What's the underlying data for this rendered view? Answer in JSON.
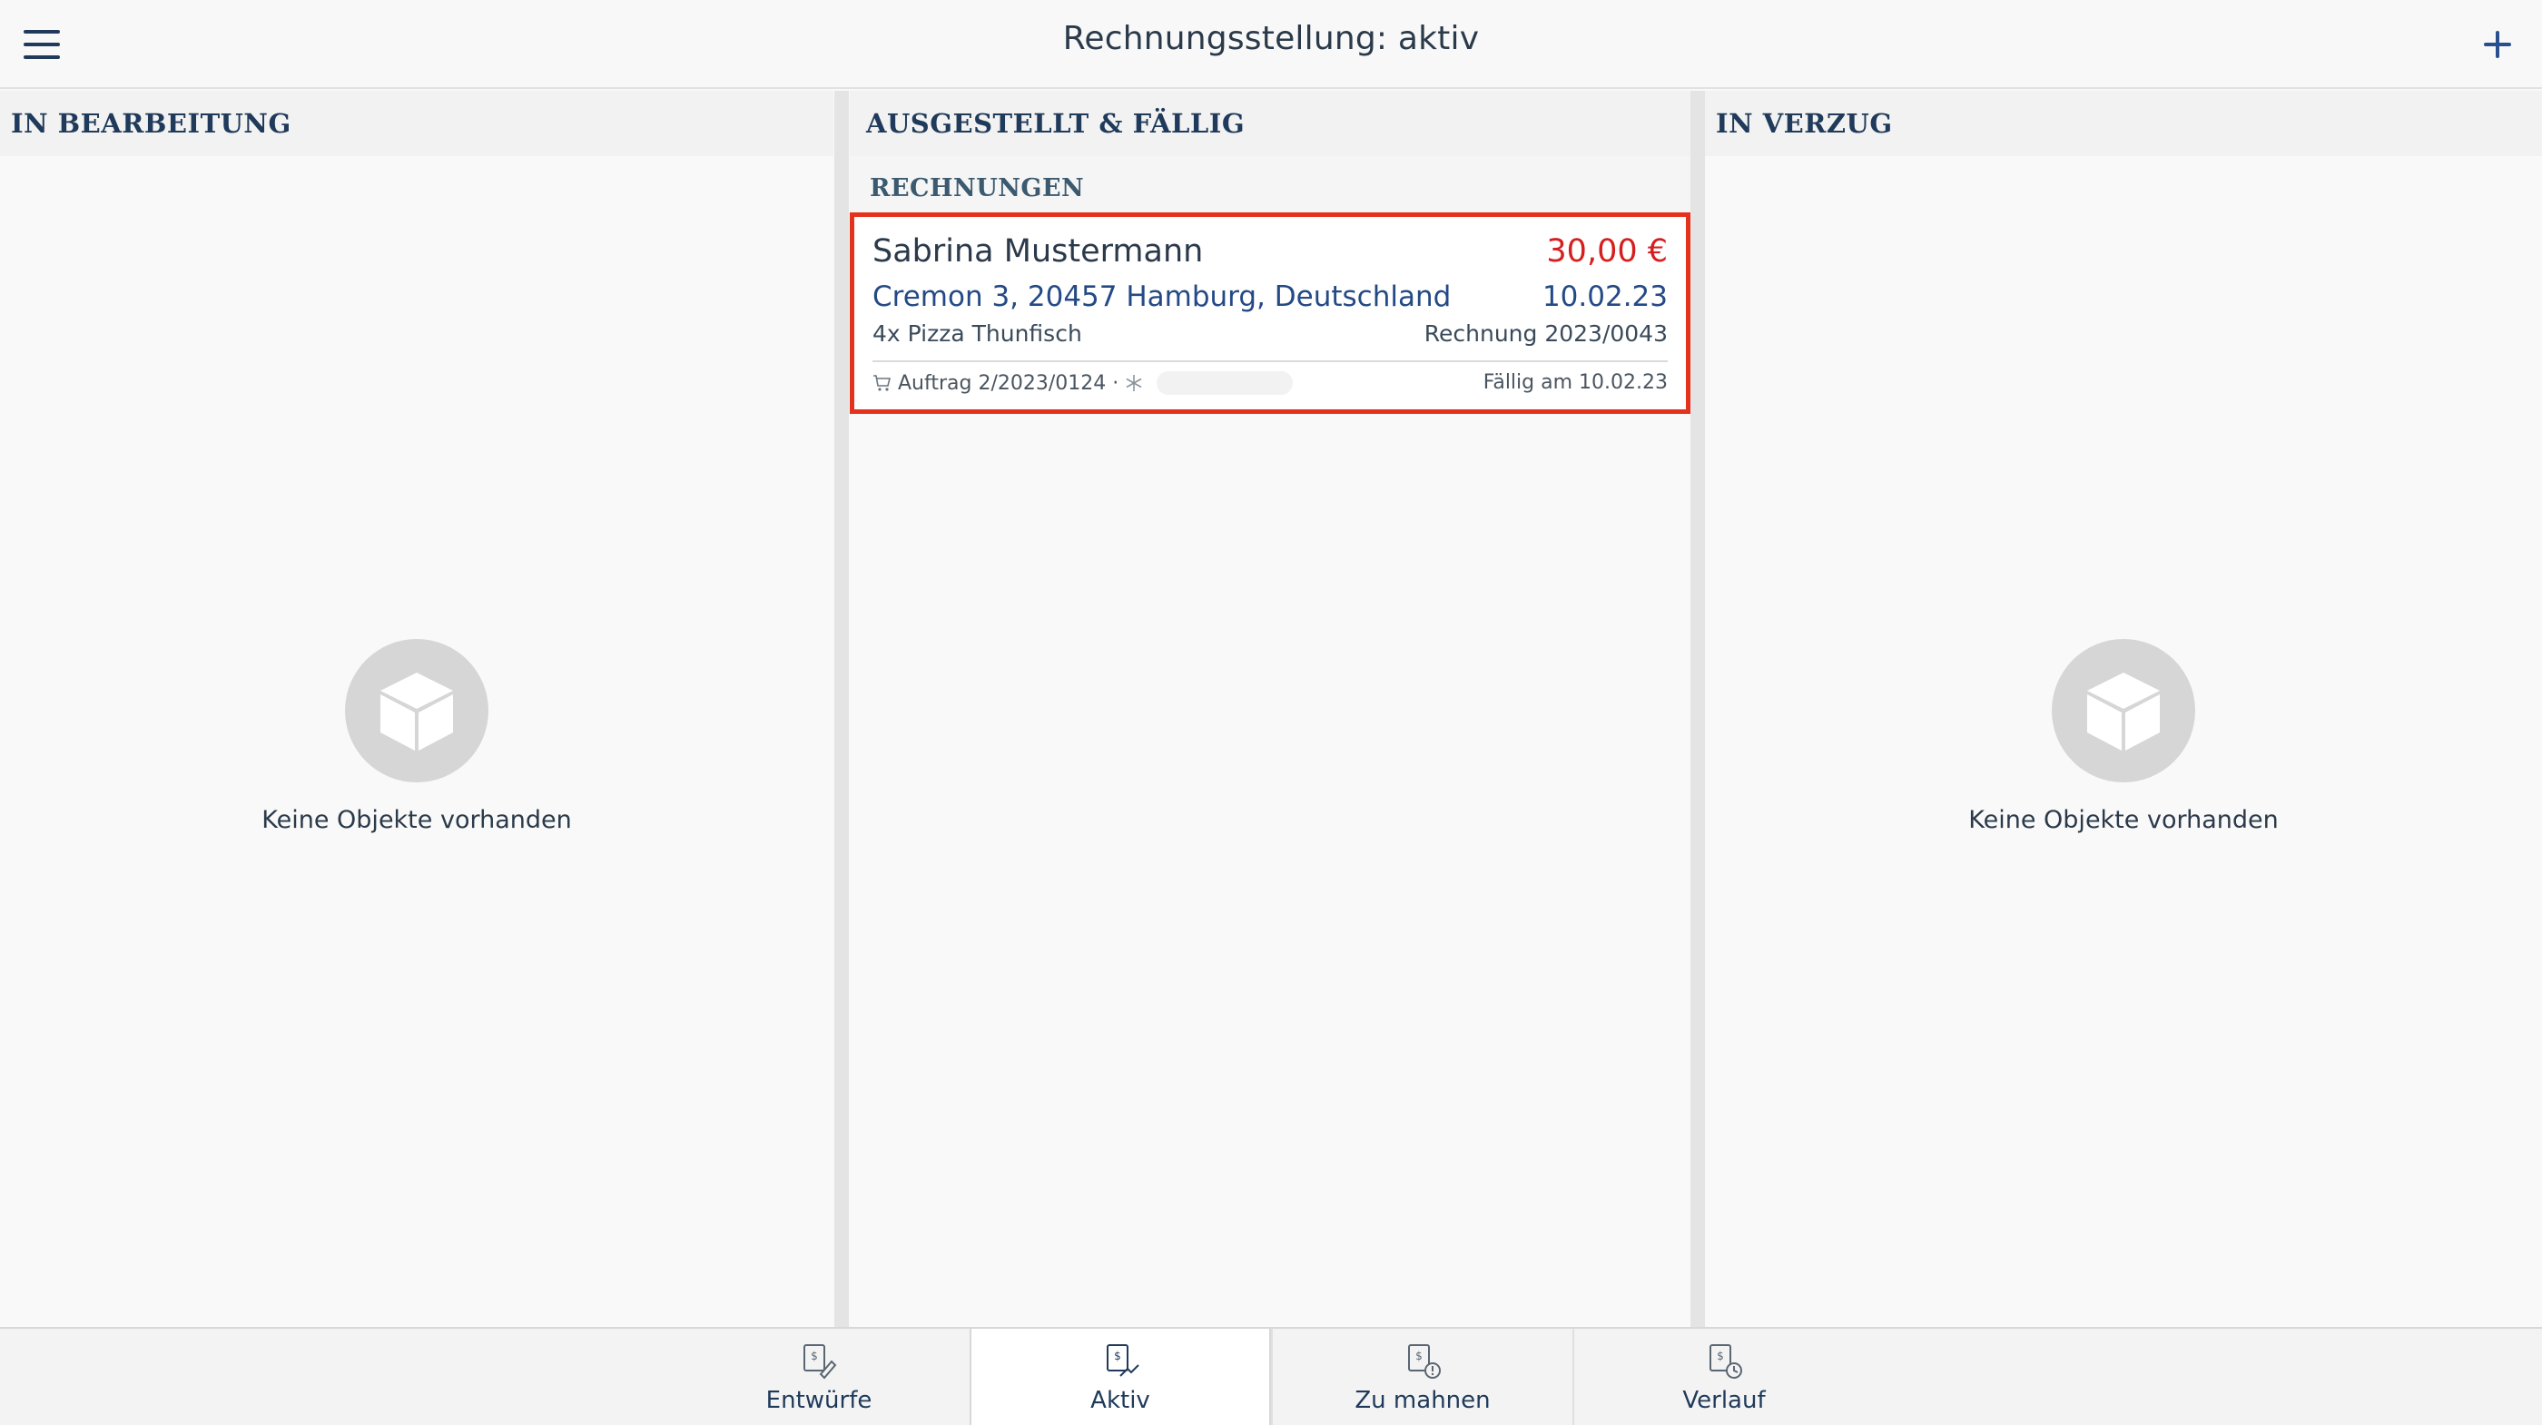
{
  "header": {
    "title": "Rechnungsstellung: aktiv",
    "menu_icon": "hamburger-menu-icon",
    "add_icon": "plus-icon"
  },
  "columns": [
    {
      "title": "IN BEARBEITUNG",
      "empty_text": "Keine Objekte vorhanden"
    },
    {
      "title": "AUSGESTELLT & FÄLLIG",
      "section": "RECHNUNGEN",
      "invoice": {
        "customer": "Sabrina Mustermann",
        "amount": "30,00 €",
        "address": "Cremon 3, 20457 Hamburg, Deutschland",
        "date": "10.02.23",
        "items": "4x Pizza Thunfisch",
        "invoice_number": "Rechnung 2023/0043",
        "order": "Auftrag 2/2023/0124 ·",
        "due": "Fällig am 10.02.23"
      }
    },
    {
      "title": "IN VERZUG",
      "empty_text": "Keine Objekte vorhanden"
    }
  ],
  "tabs": [
    {
      "label": "Entwürfe",
      "icon": "invoice-draft-icon"
    },
    {
      "label": "Aktiv",
      "icon": "invoice-active-icon",
      "selected": true
    },
    {
      "label": "Zu mahnen",
      "icon": "invoice-reminder-icon"
    },
    {
      "label": "Verlauf",
      "icon": "invoice-history-icon"
    }
  ],
  "colors": {
    "accent_red": "#e5321d",
    "amount_red": "#d51f1f",
    "navy": "#1f3a5a",
    "link_blue": "#244a86"
  }
}
